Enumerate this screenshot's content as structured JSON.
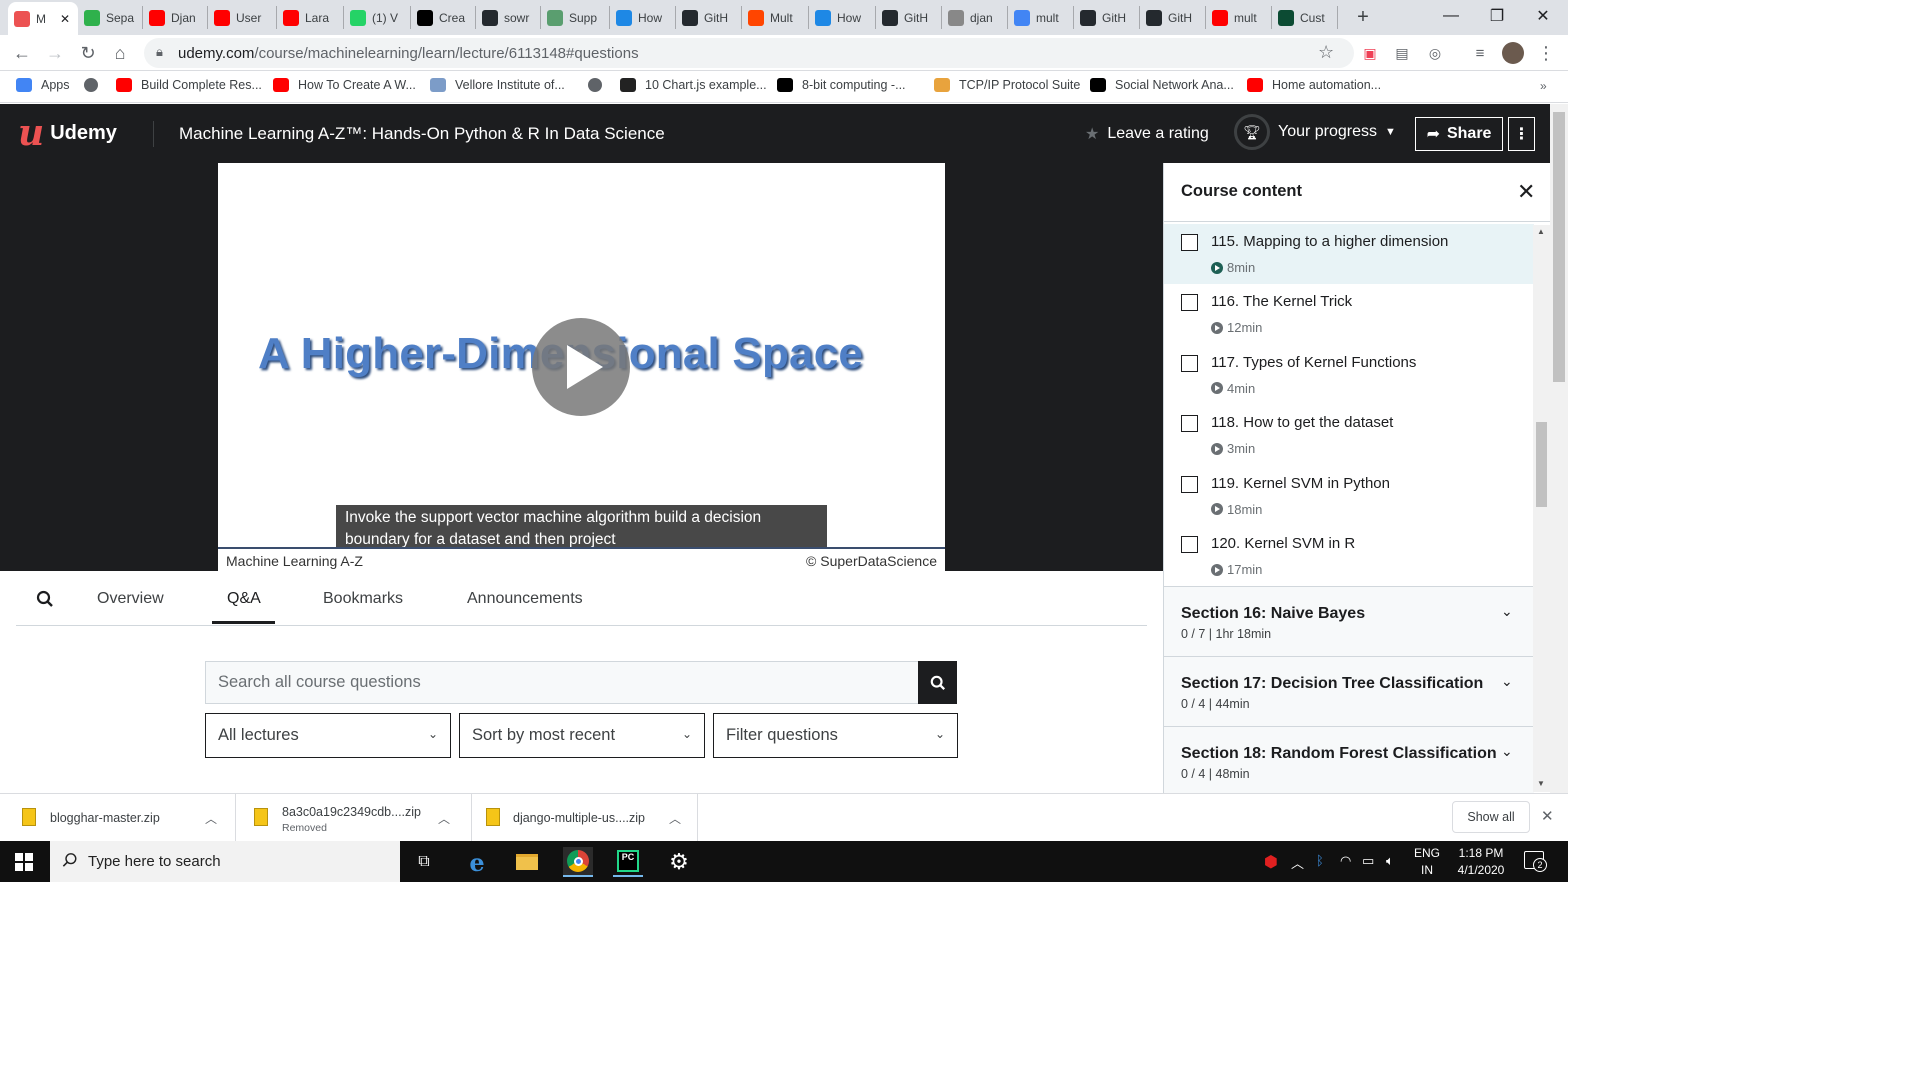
{
  "browser": {
    "tabs": [
      {
        "label": "M",
        "favicon": "udemy-icon",
        "color": "#ec5252",
        "active": true
      },
      {
        "label": "Sepa",
        "favicon": "green-h-icon",
        "color": "#2fb14c"
      },
      {
        "label": "Djan",
        "favicon": "youtube-icon",
        "color": "#ff0000"
      },
      {
        "label": "User",
        "favicon": "youtube-icon",
        "color": "#ff0000"
      },
      {
        "label": "Lara",
        "favicon": "youtube-icon",
        "color": "#ff0000"
      },
      {
        "label": "(1) V",
        "favicon": "whatsapp-icon",
        "color": "#25d366"
      },
      {
        "label": "Crea",
        "favicon": "medium-icon",
        "color": "#000000"
      },
      {
        "label": "sowr",
        "favicon": "github-icon",
        "color": "#24292e"
      },
      {
        "label": "Supp",
        "favicon": "tree-icon",
        "color": "#5a9e6f"
      },
      {
        "label": "How",
        "favicon": "s-icon",
        "color": "#1e88e5"
      },
      {
        "label": "GitH",
        "favicon": "github-icon",
        "color": "#24292e"
      },
      {
        "label": "Mult",
        "favicon": "reddit-icon",
        "color": "#ff4500"
      },
      {
        "label": "How",
        "favicon": "s-icon",
        "color": "#1e88e5"
      },
      {
        "label": "GitH",
        "favicon": "github-icon",
        "color": "#24292e"
      },
      {
        "label": "djan",
        "favicon": "globe-icon",
        "color": "#888888"
      },
      {
        "label": "mult",
        "favicon": "google-icon",
        "color": "#4285f4"
      },
      {
        "label": "GitH",
        "favicon": "github-icon",
        "color": "#24292e"
      },
      {
        "label": "GitH",
        "favicon": "github-icon",
        "color": "#24292e"
      },
      {
        "label": "mult",
        "favicon": "youtube-icon",
        "color": "#ff0000"
      },
      {
        "label": "Cust",
        "favicon": "django-icon",
        "color": "#0c4b33"
      }
    ],
    "url_host": "udemy.com",
    "url_path": "/course/machinelearning/learn/lecture/6113148#questions",
    "bookmarks": [
      {
        "label": "Apps",
        "favicon": "apps-grid-icon",
        "color": "#4285f4"
      },
      {
        "label": "",
        "favicon": "globe-icon",
        "color": "#5f6368"
      },
      {
        "label": "Build Complete Res...",
        "favicon": "youtube-icon",
        "color": "#ff0000"
      },
      {
        "label": "How To Create A W...",
        "favicon": "youtube-icon",
        "color": "#ff0000"
      },
      {
        "label": "Vellore Institute of...",
        "favicon": "vit-icon",
        "color": "#7c9cc8"
      },
      {
        "label": "",
        "favicon": "globe-icon",
        "color": "#5f6368"
      },
      {
        "label": "10 Chart.js example...",
        "favicon": "tl-icon",
        "color": "#222222"
      },
      {
        "label": "8-bit computing -...",
        "favicon": "wikipedia-icon",
        "color": "#000000"
      },
      {
        "label": "TCP/IP Protocol Suite",
        "favicon": "folder-icon",
        "color": "#e8a33d"
      },
      {
        "label": "Social Network Ana...",
        "favicon": "medium-icon",
        "color": "#000000"
      },
      {
        "label": "Home automation...",
        "favicon": "youtube-icon",
        "color": "#ff0000"
      }
    ]
  },
  "header": {
    "logo_text": "Udemy",
    "course_title": "Machine Learning A-Z™: Hands-On Python & R In Data Science",
    "rating_label": "Leave a rating",
    "progress_label": "Your progress",
    "share_label": "Share"
  },
  "video": {
    "slide_title": "A Higher-Dimensional Space",
    "caption_line1": "Invoke the support vector machine algorithm build a decision",
    "caption_line2": "boundary for a dataset and then project",
    "footer_left": "Machine Learning A-Z",
    "footer_right": "© SuperDataScience"
  },
  "content_tabs": [
    "Overview",
    "Q&A",
    "Bookmarks",
    "Announcements"
  ],
  "qa": {
    "search_placeholder": "Search all course questions",
    "filter_lectures": "All lectures",
    "sort": "Sort by most recent",
    "filter_questions": "Filter questions"
  },
  "sidebar": {
    "title": "Course content",
    "lectures": [
      {
        "title": "115. Mapping to a higher dimension",
        "duration": "8min",
        "current": true
      },
      {
        "title": "116. The Kernel Trick",
        "duration": "12min"
      },
      {
        "title": "117. Types of Kernel Functions",
        "duration": "4min"
      },
      {
        "title": "118. How to get the dataset",
        "duration": "3min"
      },
      {
        "title": "119. Kernel SVM in Python",
        "duration": "18min"
      },
      {
        "title": "120. Kernel SVM in R",
        "duration": "17min"
      }
    ],
    "sections": [
      {
        "title": "Section 16: Naive Bayes",
        "sub": "0 / 7 | 1hr 18min"
      },
      {
        "title": "Section 17: Decision Tree Classification",
        "sub": "0 / 4 | 44min"
      },
      {
        "title": "Section 18: Random Forest Classification",
        "sub": "0 / 4 | 48min"
      }
    ]
  },
  "downloads": [
    {
      "name": "blogghar-master.zip",
      "sub": ""
    },
    {
      "name": "8a3c0a19c2349cdb....zip",
      "sub": "Removed"
    },
    {
      "name": "django-multiple-us....zip",
      "sub": ""
    }
  ],
  "downloads_show_all": "Show all",
  "taskbar": {
    "search_placeholder": "Type here to search",
    "lang_line1": "ENG",
    "lang_line2": "IN",
    "time": "1:18 PM",
    "date": "4/1/2020",
    "notifications": "2"
  },
  "colors": {
    "udemy_red": "#ec5252",
    "dark": "#1c1d1f",
    "slide_blue": "#4f7fc6"
  }
}
